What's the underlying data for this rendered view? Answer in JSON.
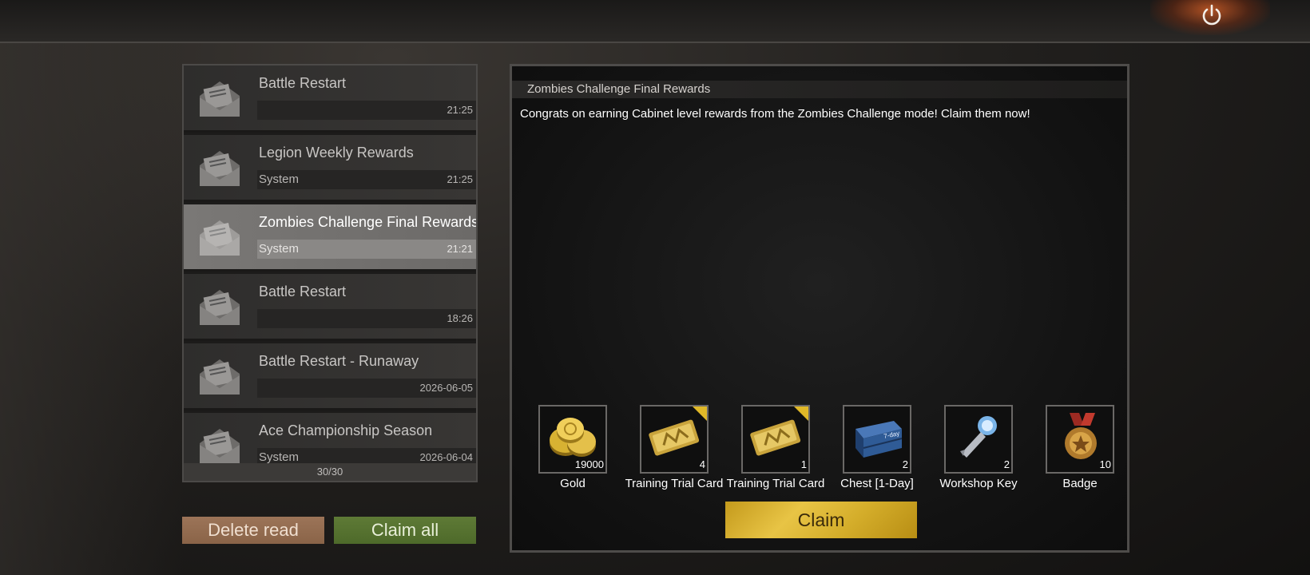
{
  "header": {
    "power_icon": "power-icon"
  },
  "mail_list": {
    "items": [
      {
        "title": "Battle Restart",
        "sender": "",
        "time": "21:25",
        "icon": "mail-envelope-icon"
      },
      {
        "title": "Legion Weekly Rewards",
        "sender": "System",
        "time": "21:25",
        "icon": "mail-envelope-icon"
      },
      {
        "title": "Zombies Challenge Final Rewards",
        "sender": "System",
        "time": "21:21",
        "icon": "mail-envelope-icon",
        "selected": true
      },
      {
        "title": "Battle Restart",
        "sender": "",
        "time": "18:26",
        "icon": "mail-envelope-icon"
      },
      {
        "title": "Battle Restart - Runaway",
        "sender": "",
        "time": "2026-06-05",
        "icon": "mail-envelope-icon"
      },
      {
        "title": "Ace Championship Season",
        "sender": "System",
        "time": "2026-06-04",
        "icon": "mail-envelope-icon"
      }
    ],
    "count": "30/30"
  },
  "actions": {
    "delete_read": "Delete read",
    "claim_all": "Claim all"
  },
  "detail": {
    "title": "Zombies Challenge Final Rewards",
    "body": "Congrats on earning Cabinet level rewards from the Zombies Challenge mode! Claim them now!",
    "rewards": [
      {
        "name": "Gold",
        "qty": "19000",
        "icon": "gold-coins-icon",
        "flag": false
      },
      {
        "name": "Training Trial Card",
        "qty": "4",
        "icon": "trial-card-icon",
        "flag": true
      },
      {
        "name": "Training Trial Card",
        "qty": "1",
        "icon": "trial-card-icon",
        "flag": true
      },
      {
        "name": "Chest [1-Day]",
        "qty": "2",
        "icon": "chest-icon",
        "flag": false
      },
      {
        "name": "Workshop Key",
        "qty": "2",
        "icon": "workshop-key-icon",
        "flag": false
      },
      {
        "name": "Badge",
        "qty": "10",
        "icon": "badge-medal-icon",
        "flag": false
      }
    ],
    "claim_label": "Claim"
  },
  "colors": {
    "claim_button": "#e0bc3a",
    "claim_all_button": "#5a7632",
    "delete_read_button": "#946c50",
    "selected_row": "#767472"
  }
}
